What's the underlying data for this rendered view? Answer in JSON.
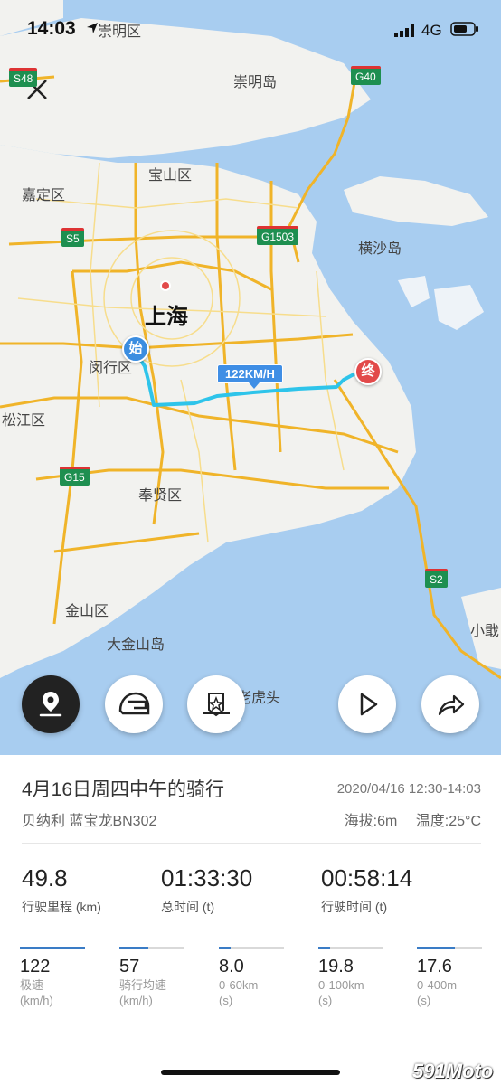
{
  "status_bar": {
    "time": "14:03",
    "network": "4G"
  },
  "map": {
    "labels": {
      "chongming_qu": "崇明区",
      "chongming_dao": "崇明岛",
      "baoshan": "宝山区",
      "jiading": "嘉定区",
      "shanghai": "上海",
      "minhang": "闵行区",
      "songjiang": "松江区",
      "fengxian": "奉贤区",
      "jinshan": "金山区",
      "dajinshan": "大金山岛",
      "hengsha": "横沙岛",
      "laohutou": "老虎头",
      "xiaoji": "小戢"
    },
    "shields": {
      "s48": "S48",
      "g40": "G40",
      "s5": "S5",
      "g1503": "G1503",
      "g15": "G15",
      "s2": "S2"
    },
    "start_marker": "始",
    "end_marker": "终",
    "max_speed_tag": "122KM/H",
    "colors": {
      "water": "#a8cdf0",
      "land": "#f2f2ef",
      "route": "#2ec4ea",
      "major_road": "#f0b429"
    }
  },
  "controls": {
    "close": "close-icon",
    "track": "location-pin-icon",
    "helmet": "helmet-icon",
    "badge": "badge-icon",
    "play": "play-icon",
    "share": "share-icon"
  },
  "ride": {
    "title": "4月16日周四中午的骑行",
    "datetime": "2020/04/16 12:30-14:03",
    "bike": "贝纳利 蓝宝龙BN302",
    "altitude": "海拔:6m",
    "temperature": "温度:25°C"
  },
  "stats": [
    {
      "value": "49.8",
      "label": "行驶里程 (km)"
    },
    {
      "value": "01:33:30",
      "label": "总时间 (t)"
    },
    {
      "value": "00:58:14",
      "label": "行驶时间 (t)"
    }
  ],
  "small_stats": [
    {
      "value": "122",
      "label1": "极速",
      "label2": "(km/h)",
      "fill": 1.0
    },
    {
      "value": "57",
      "label1": "骑行均速",
      "label2": "(km/h)",
      "fill": 0.45
    },
    {
      "value": "8.0",
      "label1": "0-60km",
      "label2": "(s)",
      "fill": 0.18
    },
    {
      "value": "19.8",
      "label1": "0-100km",
      "label2": "(s)",
      "fill": 0.18
    },
    {
      "value": "17.6",
      "label1": "0-400m",
      "label2": "(s)",
      "fill": 0.58
    }
  ],
  "watermark": "591Moto"
}
